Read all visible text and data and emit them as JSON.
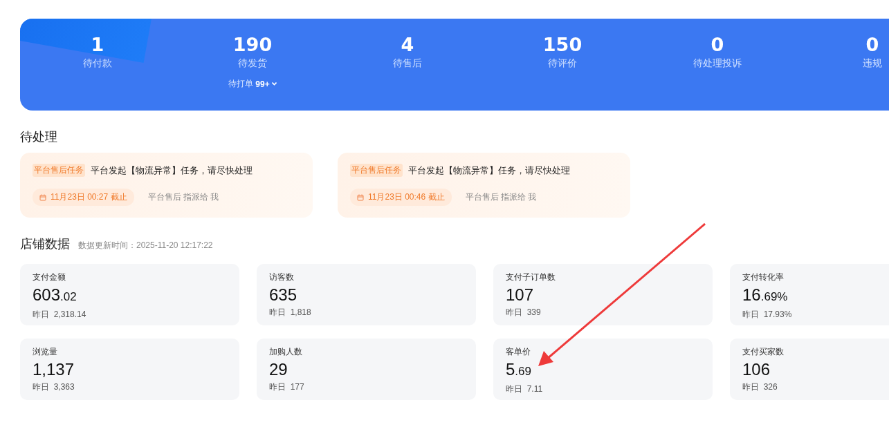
{
  "summary": [
    {
      "value": "1",
      "label": "待付款"
    },
    {
      "value": "190",
      "label": "待发货",
      "sub_label": "待打单",
      "sub_value": "99+"
    },
    {
      "value": "4",
      "label": "待售后"
    },
    {
      "value": "150",
      "label": "待评价"
    },
    {
      "value": "0",
      "label": "待处理投诉"
    },
    {
      "value": "0",
      "label": "违规"
    }
  ],
  "todo": {
    "title": "待处理",
    "tasks": [
      {
        "tag": "平台售后任务",
        "text": "平台发起【物流异常】任务，请尽快处理",
        "deadline": "11月23日 00:27 截止",
        "assignee": "平台售后 指派给 我"
      },
      {
        "tag": "平台售后任务",
        "text": "平台发起【物流异常】任务，请尽快处理",
        "deadline": "11月23日 00:46 截止",
        "assignee": "平台售后 指派给 我"
      }
    ]
  },
  "shop_data": {
    "title": "店铺数据",
    "updated": "数据更新时间：2025-11-20 12:17:22",
    "metrics": [
      {
        "label": "支付金额",
        "value_main": "603",
        "value_fraction": ".02",
        "yesterday_label": "昨日",
        "yesterday": "2,318.14"
      },
      {
        "label": "访客数",
        "value_main": "635",
        "yesterday_label": "昨日",
        "yesterday": "1,818"
      },
      {
        "label": "支付子订单数",
        "value_main": "107",
        "yesterday_label": "昨日",
        "yesterday": "339"
      },
      {
        "label": "支付转化率",
        "value_main": "16",
        "value_fraction": ".69%",
        "yesterday_label": "昨日",
        "yesterday": "17.93%"
      },
      {
        "label": "浏览量",
        "value_main": "1,137",
        "yesterday_label": "昨日",
        "yesterday": "3,363"
      },
      {
        "label": "加购人数",
        "value_main": "29",
        "yesterday_label": "昨日",
        "yesterday": "177"
      },
      {
        "label": "客单价",
        "value_main": "5",
        "value_fraction": ".69",
        "yesterday_label": "昨日",
        "yesterday": "7.11"
      },
      {
        "label": "支付买家数",
        "value_main": "106",
        "yesterday_label": "昨日",
        "yesterday": "326"
      }
    ]
  }
}
